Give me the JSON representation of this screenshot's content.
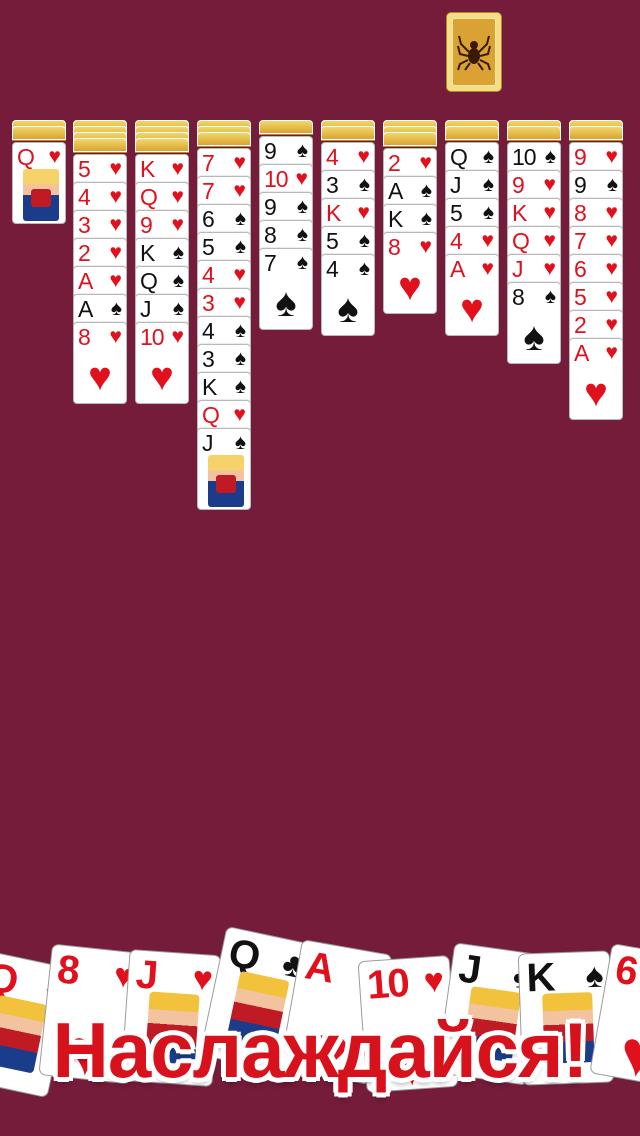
{
  "colors": {
    "felt": "#741c39",
    "red_suit": "#e0101d",
    "black_suit": "#111111",
    "card_back": "#d9a233",
    "banner_text": "#d8121c"
  },
  "stock": {
    "icon": "spider-icon"
  },
  "tableau": [
    {
      "backs": 2,
      "cards": [
        {
          "rank": "Q",
          "suit": "♥",
          "face": true
        }
      ]
    },
    {
      "backs": 4,
      "cards": [
        {
          "rank": "5",
          "suit": "♥"
        },
        {
          "rank": "4",
          "suit": "♥"
        },
        {
          "rank": "3",
          "suit": "♥"
        },
        {
          "rank": "2",
          "suit": "♥"
        },
        {
          "rank": "A",
          "suit": "♥"
        },
        {
          "rank": "A",
          "suit": "♠"
        },
        {
          "rank": "8",
          "suit": "♥"
        }
      ]
    },
    {
      "backs": 4,
      "cards": [
        {
          "rank": "K",
          "suit": "♥"
        },
        {
          "rank": "Q",
          "suit": "♥"
        },
        {
          "rank": "9",
          "suit": "♥"
        },
        {
          "rank": "K",
          "suit": "♠"
        },
        {
          "rank": "Q",
          "suit": "♠"
        },
        {
          "rank": "J",
          "suit": "♠"
        },
        {
          "rank": "10",
          "suit": "♥"
        }
      ]
    },
    {
      "backs": 3,
      "cards": [
        {
          "rank": "7",
          "suit": "♥"
        },
        {
          "rank": "7",
          "suit": "♥"
        },
        {
          "rank": "6",
          "suit": "♠"
        },
        {
          "rank": "5",
          "suit": "♠"
        },
        {
          "rank": "4",
          "suit": "♥"
        },
        {
          "rank": "3",
          "suit": "♥"
        },
        {
          "rank": "4",
          "suit": "♠"
        },
        {
          "rank": "3",
          "suit": "♠"
        },
        {
          "rank": "K",
          "suit": "♠"
        },
        {
          "rank": "Q",
          "suit": "♥"
        },
        {
          "rank": "J",
          "suit": "♠",
          "face": true
        }
      ]
    },
    {
      "backs": 1,
      "cards": [
        {
          "rank": "9",
          "suit": "♠"
        },
        {
          "rank": "10",
          "suit": "♥"
        },
        {
          "rank": "9",
          "suit": "♠"
        },
        {
          "rank": "8",
          "suit": "♠"
        },
        {
          "rank": "7",
          "suit": "♠"
        }
      ]
    },
    {
      "backs": 2,
      "cards": [
        {
          "rank": "4",
          "suit": "♥"
        },
        {
          "rank": "3",
          "suit": "♠"
        },
        {
          "rank": "K",
          "suit": "♥"
        },
        {
          "rank": "5",
          "suit": "♠"
        },
        {
          "rank": "4",
          "suit": "♠"
        }
      ]
    },
    {
      "backs": 3,
      "cards": [
        {
          "rank": "2",
          "suit": "♥"
        },
        {
          "rank": "A",
          "suit": "♠"
        },
        {
          "rank": "K",
          "suit": "♠"
        },
        {
          "rank": "8",
          "suit": "♥"
        }
      ]
    },
    {
      "backs": 2,
      "cards": [
        {
          "rank": "Q",
          "suit": "♠"
        },
        {
          "rank": "J",
          "suit": "♠"
        },
        {
          "rank": "5",
          "suit": "♠"
        },
        {
          "rank": "4",
          "suit": "♥"
        },
        {
          "rank": "A",
          "suit": "♥"
        }
      ]
    },
    {
      "backs": 2,
      "cards": [
        {
          "rank": "10",
          "suit": "♠"
        },
        {
          "rank": "9",
          "suit": "♥"
        },
        {
          "rank": "K",
          "suit": "♥"
        },
        {
          "rank": "Q",
          "suit": "♥"
        },
        {
          "rank": "J",
          "suit": "♥"
        },
        {
          "rank": "8",
          "suit": "♠"
        }
      ]
    },
    {
      "backs": 2,
      "cards": [
        {
          "rank": "9",
          "suit": "♥"
        },
        {
          "rank": "9",
          "suit": "♠"
        },
        {
          "rank": "8",
          "suit": "♥"
        },
        {
          "rank": "7",
          "suit": "♥"
        },
        {
          "rank": "6",
          "suit": "♥"
        },
        {
          "rank": "5",
          "suit": "♥"
        },
        {
          "rank": "2",
          "suit": "♥"
        },
        {
          "rank": "A",
          "suit": "♥"
        }
      ]
    }
  ],
  "fan": [
    {
      "rank": "Q",
      "suit": "♦",
      "face": true
    },
    {
      "rank": "8",
      "suit": "♥"
    },
    {
      "rank": "J",
      "suit": "♥",
      "face": true
    },
    {
      "rank": "Q",
      "suit": "♣",
      "face": true
    },
    {
      "rank": "A",
      "suit": "♥"
    },
    {
      "rank": "10",
      "suit": "♥"
    },
    {
      "rank": "J",
      "suit": "♣",
      "face": true
    },
    {
      "rank": "K",
      "suit": "♠",
      "face": true
    },
    {
      "rank": "6",
      "suit": "♥"
    }
  ],
  "banner": {
    "text": "Наслаждайся!"
  }
}
